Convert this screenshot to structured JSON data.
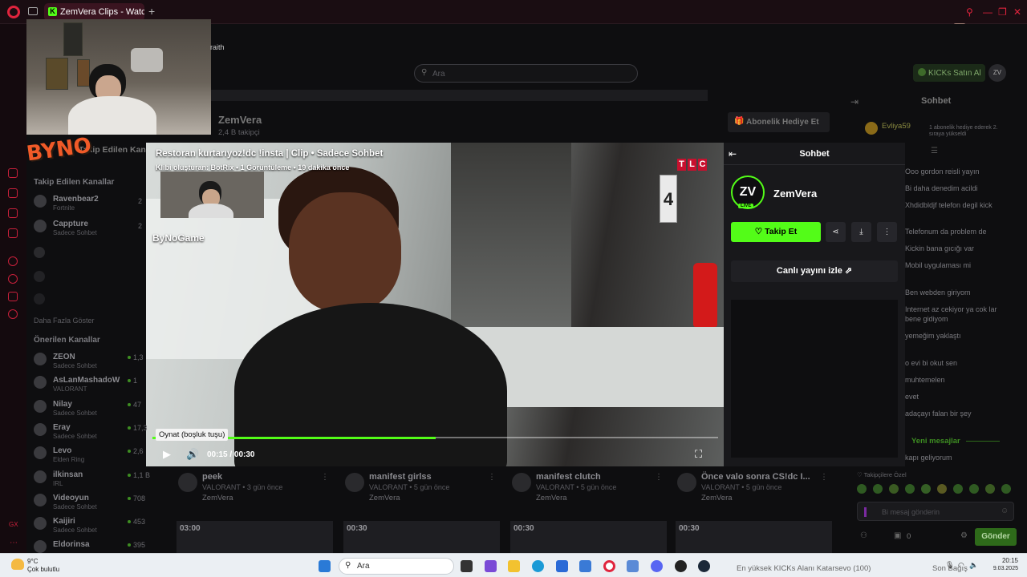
{
  "browser": {
    "tab_title": "ZemVera Clips - Watch Live",
    "tab_icon_letter": "K",
    "toolbar_ai": "AI"
  },
  "webcam": {
    "overlay_name": "raith",
    "logo_text": "BYNO"
  },
  "site": {
    "search_placeholder": "Ara",
    "buy_kicks": "KICKs Satın Al",
    "profile_initials": "ZV",
    "channel_name": "ZemVera",
    "followers": "2,4 B takipçi",
    "gift_sub": "Abonelik Hediye Et",
    "chat_title": "Sohbet",
    "gifter_name": "Evliya59",
    "gifter_text": "1 abonelik hediye ederek 2. sıraya yükseldi",
    "followed_channels_heading": "Takip Edilen Kanallar",
    "show_more": "Daha Fazla Göster",
    "recommended_heading": "Önerilen Kanallar",
    "followed": [
      {
        "name": "Ravenbear2",
        "game": "Fortnite",
        "count": "2"
      },
      {
        "name": "Cappture",
        "game": "Sadece Sohbet",
        "count": "2"
      }
    ],
    "recommended": [
      {
        "name": "ZEON",
        "game": "Sadece Sohbet",
        "count": "1,3"
      },
      {
        "name": "AsLanMashadoW",
        "game": "VALORANT",
        "count": "1"
      },
      {
        "name": "Nilay",
        "game": "Sadece Sohbet",
        "count": "47"
      },
      {
        "name": "Eray",
        "game": "Sadece Sohbet",
        "count": "17,3"
      },
      {
        "name": "Levo",
        "game": "Elden Ring",
        "count": "2,6"
      },
      {
        "name": "ilkinsan",
        "game": "IRL",
        "count": "1,1 B"
      },
      {
        "name": "Videoyun",
        "game": "Sadece Sohbet",
        "count": "708"
      },
      {
        "name": "Kaijiri",
        "game": "Sadece Sohbet",
        "count": "453"
      },
      {
        "name": "Eldorinsa",
        "game": "",
        "count": "395"
      }
    ],
    "chat_messages": [
      "Ooo gordon reisli yayın",
      "Bi daha denedim acildi",
      "Xhdidbldjf telefon degil kick",
      "Telefonum da problem de",
      "Kickin bana gıcığı var",
      "Mobil uygulaması mi",
      "Ben webden giriyom",
      "Internet az cekiyor ya cok lar bene gidiyom",
      "yemeğim yaklaştı",
      "o evi bi okut sen",
      "muhtemelen",
      "evet",
      "adaçayı falan bir şey",
      "kapı geliyorum"
    ],
    "new_messages": "Yeni mesajlar",
    "followers_only": "Takipçilere Özel",
    "chat_input_placeholder": "Bi mesaj gönderin",
    "send": "Gönder",
    "kicks_count": "0",
    "clips": [
      {
        "title": "peek",
        "game": "VALORANT",
        "age": "3 gün önce",
        "channel": "ZemVera"
      },
      {
        "title": "manifest girlss",
        "game": "VALORANT",
        "age": "5 gün önce",
        "channel": "ZemVera"
      },
      {
        "title": "manifest clutch",
        "game": "VALORANT",
        "age": "5 gün önce",
        "channel": "ZemVera"
      },
      {
        "title": "Önce valo sonra CS!dc I...",
        "game": "VALORANT",
        "age": "5 gün önce",
        "channel": "ZemVera"
      }
    ],
    "thumb_durations": [
      "03:00",
      "00:30",
      "00:30",
      "00:30"
    ]
  },
  "modal": {
    "title": "Restoran kurtarıyoz!dc !insta | Clip • Sadece Sohbet",
    "subtitle": "Klibi oluşturan: BotRix • 1 Görüntüleme • 19 dakika önce",
    "tlc": [
      "T",
      "L",
      "C"
    ],
    "watermark": "ByNoGame",
    "tooltip": "Oynat (boşluk tuşu)",
    "time": "00:15 / 00:30",
    "progress": 0.5,
    "chat_title": "Sohbet",
    "channel_name": "ZemVera",
    "avatar_initials": "ZV",
    "live_badge": "LIVE",
    "follow_label": "Takip Et",
    "watch_live_label": "Canlı yayını izle"
  },
  "taskbar": {
    "weather_temp": "9°C",
    "weather_desc": "Çok bulutlu",
    "search_label": "Ara",
    "ticker": "En yüksek KICKs Alanı Katarsevo (100)",
    "ticker_right": "Son Bağış",
    "clock": "20:15",
    "date": "9.03.2025"
  },
  "colors": {
    "kick_green": "#53fc18",
    "opera_red": "#e0243d",
    "tlc_red": "#c8102e"
  }
}
